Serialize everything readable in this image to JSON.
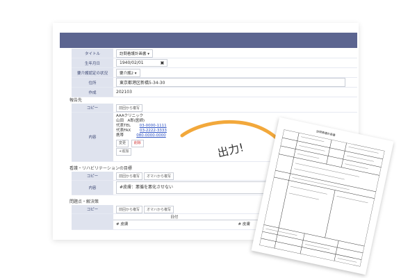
{
  "form": {
    "title_label": "タイトル",
    "title_value": "訪問看護計画書",
    "birth_label": "生年月日",
    "birth_value": "1940/02/01",
    "care_label": "要介護認定の状況",
    "care_value": "要介護2",
    "address_label": "住所",
    "address_value": "東京都港区新橋5-34-30",
    "date_label": "作成",
    "date_value": "202103"
  },
  "report": {
    "section_title": "報告先",
    "copy_label": "コピー",
    "copy_btn": "前回から複写",
    "content_label": "内容",
    "clinic": "AAAクリニック",
    "doctor": "山田　A郎(医師)",
    "tel_label": "代表TEL",
    "tel": "03-0000-1111",
    "fax_label": "代表FAX",
    "fax": "03-2222-3333",
    "mobile_label": "携帯",
    "mobile": "080-0000-0000",
    "change_btn": "変更",
    "delete_btn": "削除",
    "add_btn": "+追加"
  },
  "nursing": {
    "section_title": "看護・リハビリテーションの目標",
    "copy_label": "コピー",
    "copy_btn1": "前回から複写",
    "copy_btn2": "オマハから複写",
    "content_label": "内容",
    "content_value": "#皮膚：悪循を悪化させない"
  },
  "issues": {
    "section_title": "問題点・解決策",
    "copy_label": "コピー",
    "copy_btn1": "前回から複写",
    "copy_btn2": "オマハから複写",
    "col_date": "日付",
    "col_content": "内容",
    "row_left": "# 皮膚",
    "row_right": "# 皮膚"
  },
  "overlay": {
    "output_text": "出力!",
    "sheet_title": "訪問看護計画書"
  },
  "colors": {
    "header": "#5c6590",
    "label_bg": "#dfe3ee",
    "arrow": "#f2a83b",
    "link": "#2a4fc2"
  }
}
